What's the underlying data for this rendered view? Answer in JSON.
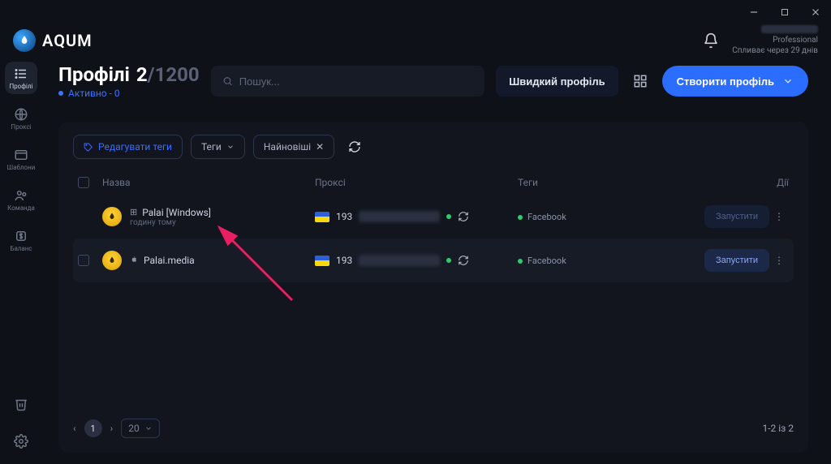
{
  "brand": "AQUM",
  "window": {
    "minimize": "—",
    "maximize": "▢",
    "close": "✕"
  },
  "account": {
    "tier": "Professional",
    "expiry": "Спливає через 29 днів"
  },
  "sidebar": {
    "items": [
      {
        "label": "Профілі"
      },
      {
        "label": "Проксі"
      },
      {
        "label": "Шаблони"
      },
      {
        "label": "Команда"
      },
      {
        "label": "Баланс"
      }
    ]
  },
  "page": {
    "title": "Профілі",
    "count_used": "2",
    "count_total": "/1200",
    "active_text": "Активно - 0",
    "search_placeholder": "Пошук..."
  },
  "header_actions": {
    "quick_profile": "Швидкий профіль",
    "create_profile": "Створити профіль"
  },
  "filters": {
    "edit_tags": "Редагувати теги",
    "tags_label": "Теги",
    "sort_label": "Найновіші"
  },
  "table": {
    "columns": {
      "name": "Назва",
      "proxy": "Проксі",
      "tags": "Теги",
      "actions": "Дії"
    },
    "rows": [
      {
        "name": "Palai [Windows]",
        "subtitle": "годину тому",
        "platform": "windows",
        "ip_prefix": "193",
        "proxy_status": "ok",
        "tag": "Facebook",
        "launch": "Запустити",
        "launch_state": "dim"
      },
      {
        "name": "Palai.media",
        "subtitle": "",
        "platform": "apple",
        "ip_prefix": "193",
        "proxy_status": "ok",
        "tag": "Facebook",
        "launch": "Запустити",
        "launch_state": "normal"
      }
    ]
  },
  "pagination": {
    "page": "1",
    "page_size": "20",
    "range": "1-2 із 2"
  },
  "colors": {
    "accent": "#2b6eff",
    "background": "#0e1117",
    "panel": "#12151e",
    "success": "#2ecc71"
  }
}
